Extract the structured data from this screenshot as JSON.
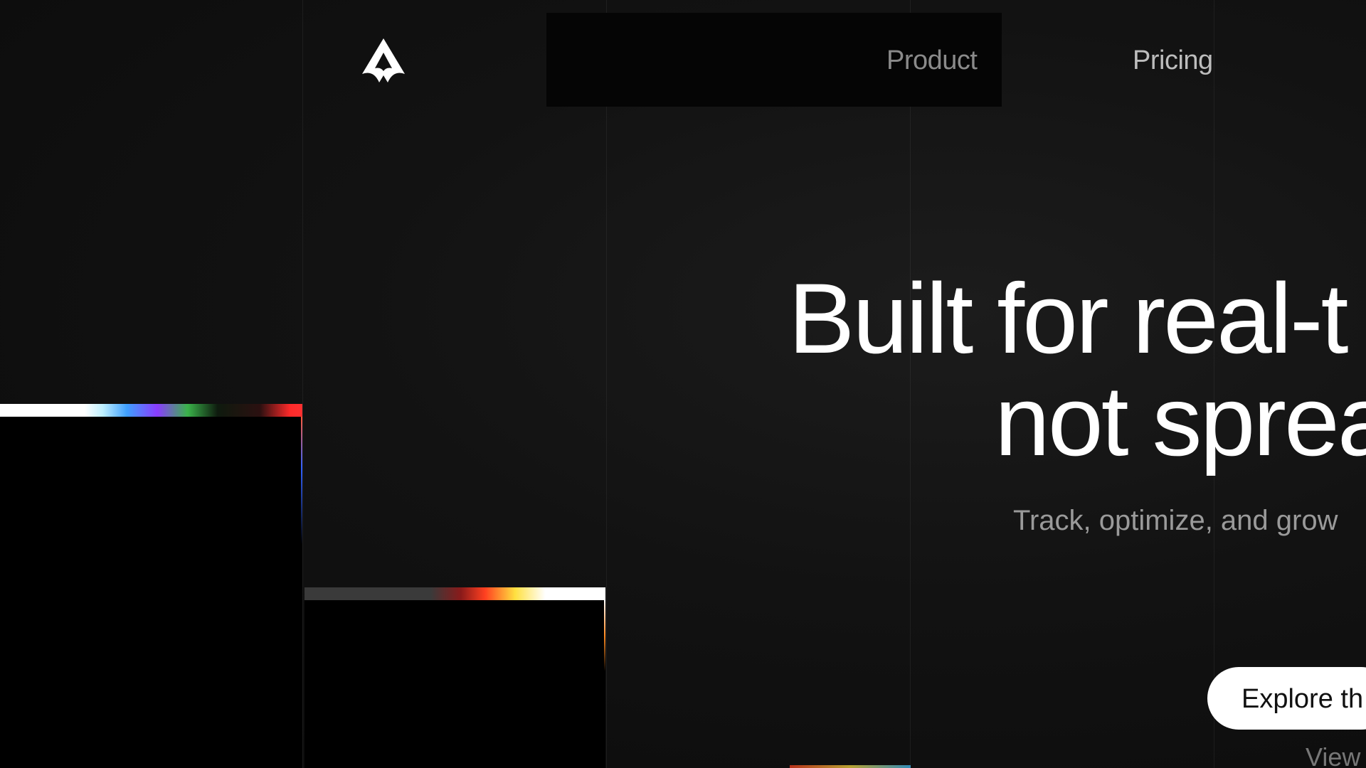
{
  "nav": {
    "logo_icon": "star-triangle-logo-icon",
    "links": [
      {
        "label": "Product"
      },
      {
        "label": "Pricing"
      }
    ]
  },
  "hero": {
    "headline_line1": "Built for real-t",
    "headline_line2": "not sprea",
    "subtitle": "Track, optimize, and grow",
    "cta_label": "Explore th",
    "secondary_link": "View"
  },
  "colors": {
    "background": "#121212",
    "headline": "#ffffff",
    "subtitle": "#9a9a9a",
    "cta_background": "#ffffff",
    "cta_text": "#111111"
  }
}
